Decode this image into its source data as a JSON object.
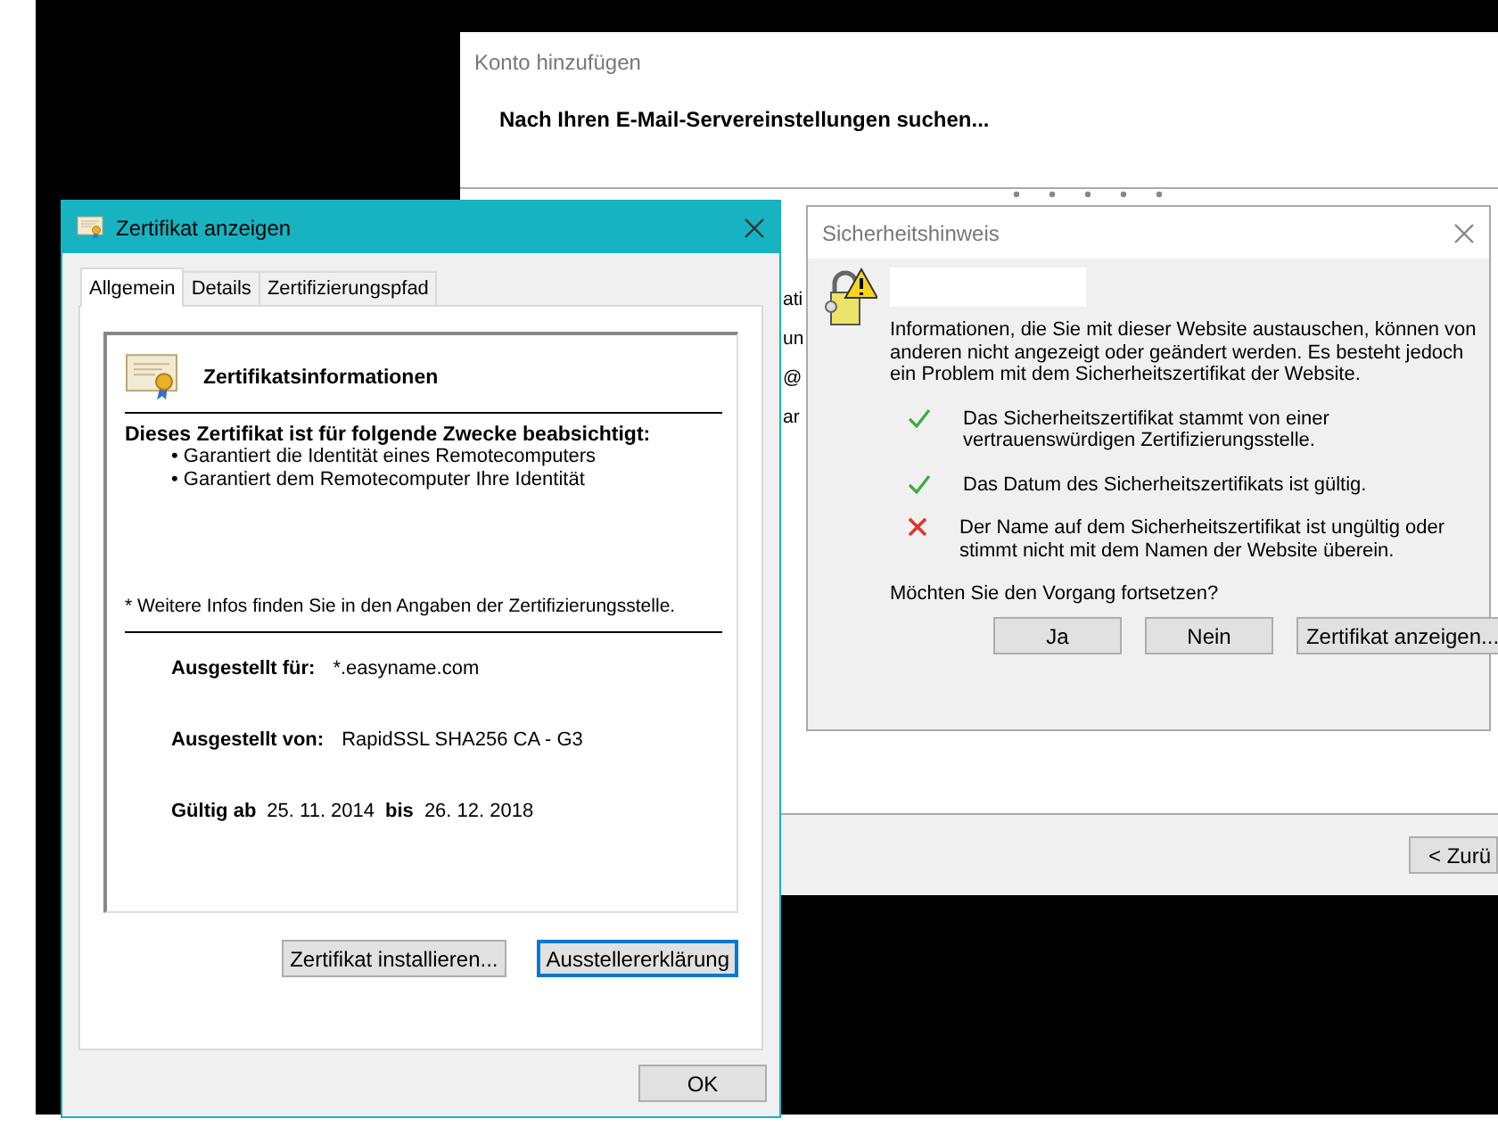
{
  "background_window": {
    "title": "Konto hinzufügen",
    "heading": "Nach Ihren E-Mail-Servereinstellungen suchen...",
    "partial_lines": [
      "ati",
      "un",
      "@",
      "ar"
    ],
    "back_button": "< Zurü"
  },
  "certificate_dialog": {
    "title": "Zertifikat anzeigen",
    "tabs": [
      {
        "label": "Allgemein",
        "selected": true
      },
      {
        "label": "Details",
        "selected": false
      },
      {
        "label": "Zertifizierungspfad",
        "selected": false
      }
    ],
    "heading": "Zertifikatsinformationen",
    "purpose_title": "Dieses Zertifikat ist für folgende Zwecke beabsichtigt:",
    "purposes": [
      "• Garantiert die Identität eines Remotecomputers",
      "• Garantiert dem Remotecomputer Ihre Identität"
    ],
    "note": "* Weitere Infos finden Sie in den Angaben der Zertifizierungsstelle.",
    "fields": [
      {
        "label": "Ausgestellt für:",
        "value": "*.easyname.com"
      },
      {
        "label": "Ausgestellt von:",
        "value": "RapidSSL SHA256 CA - G3"
      }
    ],
    "validity": {
      "from_label": "Gültig ab",
      "from": "25. 11. 2014",
      "to_label": "bis",
      "to": "26. 12. 2018"
    },
    "buttons": [
      {
        "label": "Zertifikat installieren...",
        "focused": false
      },
      {
        "label": "Ausstellererklärung",
        "focused": true
      }
    ],
    "ok_button": "OK"
  },
  "security_dialog": {
    "title": "Sicherheitshinweis",
    "message": "Informationen, die Sie mit dieser Website austauschen, können von anderen nicht angezeigt oder geändert werden. Es besteht jedoch ein Problem mit dem Sicherheitszertifikat der Website.",
    "checks": [
      {
        "kind": "pass",
        "text": "Das Sicherheitszertifikat stammt von einer vertrauenswürdigen Zertifizierungsstelle."
      },
      {
        "kind": "pass",
        "text": "Das Datum des Sicherheitszertifikats ist gültig."
      },
      {
        "kind": "fail",
        "text": "Der Name auf dem Sicherheitszertifikat ist ungültig oder stimmt nicht mit dem Namen der Website überein."
      }
    ],
    "question": "Möchten Sie den Vorgang fortsetzen?",
    "buttons": [
      "Ja",
      "Nein",
      "Zertifikat anzeigen..."
    ]
  }
}
